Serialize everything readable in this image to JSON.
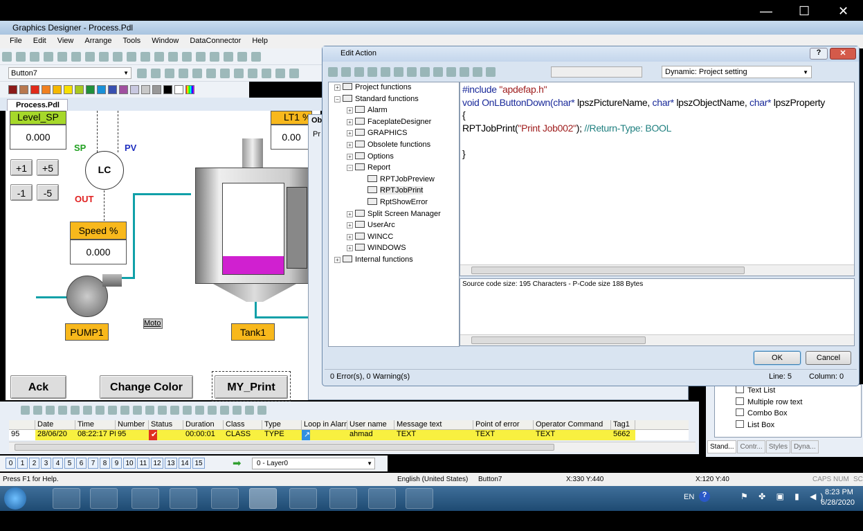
{
  "window": {
    "title": "Graphics Designer - Process.Pdl",
    "minimize": "—",
    "maximize": "☐",
    "close": "✕"
  },
  "menu": [
    "File",
    "Edit",
    "View",
    "Arrange",
    "Tools",
    "Window",
    "DataConnector",
    "Help"
  ],
  "object_combo": "Button7",
  "palette": [
    "#8b1a1a",
    "#b87850",
    "#e02a1a",
    "#f08020",
    "#f5b800",
    "#f8e000",
    "#a8c820",
    "#20903a",
    "#1890d8",
    "#3850b0",
    "#a050a0",
    "#c8c8e0",
    "#c8c8c8",
    "#989898",
    "#000000",
    "#ffffff"
  ],
  "doc_tab": {
    "label": "Process.Pdl",
    "close": "✕"
  },
  "canvas": {
    "level_sp": {
      "label": "Level_SP",
      "value": "0.000"
    },
    "step_buttons": [
      "+1",
      "+5",
      "-1",
      "-5"
    ],
    "sp": "SP",
    "pv": "PV",
    "lc": "LC",
    "out": "OUT",
    "speed": {
      "label": "Speed %",
      "value": "0.000"
    },
    "lt1": {
      "label": "LT1 %",
      "value": "0.00"
    },
    "pump": "PUMP1",
    "tank": "Tank1",
    "motor": "Moto",
    "buttons": {
      "ack": "Ack",
      "change_color": "Change Color",
      "my_print": "MY_Print"
    },
    "colors": {
      "pipe": "#10a0a8",
      "header_green": "#a6d82a",
      "header_orange": "#f8b81c",
      "tank_liquid": "#d020d0"
    }
  },
  "behind_panel": {
    "obj_tab": "Obj",
    "pr_tab": "Pr"
  },
  "dialog": {
    "title": "Edit Action",
    "help": "?",
    "close": "✕",
    "dynamic_select": "Dynamic: Project setting",
    "tree": [
      {
        "label": "Project functions",
        "level": 0,
        "exp": "+"
      },
      {
        "label": "Standard functions",
        "level": 0,
        "exp": "−"
      },
      {
        "label": "Alarm",
        "level": 1,
        "exp": "+"
      },
      {
        "label": "FaceplateDesigner",
        "level": 1,
        "exp": "+"
      },
      {
        "label": "GRAPHICS",
        "level": 1,
        "exp": "+"
      },
      {
        "label": "Obsolete functions",
        "level": 1,
        "exp": "+"
      },
      {
        "label": "Options",
        "level": 1,
        "exp": "+"
      },
      {
        "label": "Report",
        "level": 1,
        "exp": "−"
      },
      {
        "label": "RPTJobPreview",
        "level": 2,
        "exp": ""
      },
      {
        "label": "RPTJobPrint",
        "level": 2,
        "exp": ""
      },
      {
        "label": "RptShowError",
        "level": 2,
        "exp": ""
      },
      {
        "label": "Split Screen Manager",
        "level": 1,
        "exp": "+"
      },
      {
        "label": "UserArc",
        "level": 1,
        "exp": "+"
      },
      {
        "label": "WINCC",
        "level": 1,
        "exp": "+"
      },
      {
        "label": "WINDOWS",
        "level": 1,
        "exp": "+"
      },
      {
        "label": "Internal functions",
        "level": 0,
        "exp": "+"
      }
    ],
    "code": {
      "l1a": "#include ",
      "l1b": "\"apdefap.h\"",
      "l2a": "void OnLButtonDown(",
      "l2b": "char*",
      "l2c": " lpszPictureName, ",
      "l2d": "char*",
      "l2e": " lpszObjectName, ",
      "l2f": "char*",
      "l2g": " lpszProperty",
      "l3": "{",
      "l4a": "RPTJobPrint(",
      "l4b": "\"Print Job002\"",
      "l4c": ");   ",
      "l4d": "//Return-Type: BOOL",
      "l6": "}"
    },
    "output": "Source code size: 195 Characters - P-Code size 188 Bytes",
    "ok": "OK",
    "cancel": "Cancel",
    "status": {
      "errors": "0 Error(s), 0 Warning(s)",
      "line": "Line: 5",
      "column": "Column: 0"
    }
  },
  "right_panel": {
    "items": [
      "Text List",
      "Multiple row text",
      "Combo Box",
      "List Box"
    ],
    "tabs": [
      "Stand...",
      "Contr...",
      "Styles",
      "Dyna..."
    ]
  },
  "alarm_table": {
    "columns": [
      "",
      "Date",
      "Time",
      "Number",
      "Status",
      "Duration",
      "Class",
      "Type",
      "Loop in Alarm",
      "User name",
      "Message text",
      "Point of error",
      "Operator Command",
      "Tag1"
    ],
    "rows": [
      [
        "95",
        "28/06/20",
        "08:22:17 PM",
        "95",
        "✔",
        "00:00:01",
        "CLASS",
        "TYPE",
        "↗",
        "ahmad",
        "TEXT",
        "TEXT",
        "TEXT",
        "5662"
      ]
    ],
    "row_color": "#f8f040"
  },
  "layers": {
    "buttons": [
      "0",
      "1",
      "2",
      "3",
      "4",
      "5",
      "6",
      "7",
      "8",
      "9",
      "10",
      "11",
      "12",
      "13",
      "14",
      "15"
    ],
    "selected": "0 - Layer0"
  },
  "statusbar": {
    "help": "Press F1 for Help.",
    "language": "English (United States)",
    "object": "Button7",
    "position": "X:330 Y:440",
    "size": "X:120 Y:40",
    "caps": "CAPS",
    "num": "NUM",
    "scrl": "SCRL"
  },
  "taskbar": {
    "lang": "EN",
    "time": "8:23 PM",
    "date": "6/28/2020"
  }
}
